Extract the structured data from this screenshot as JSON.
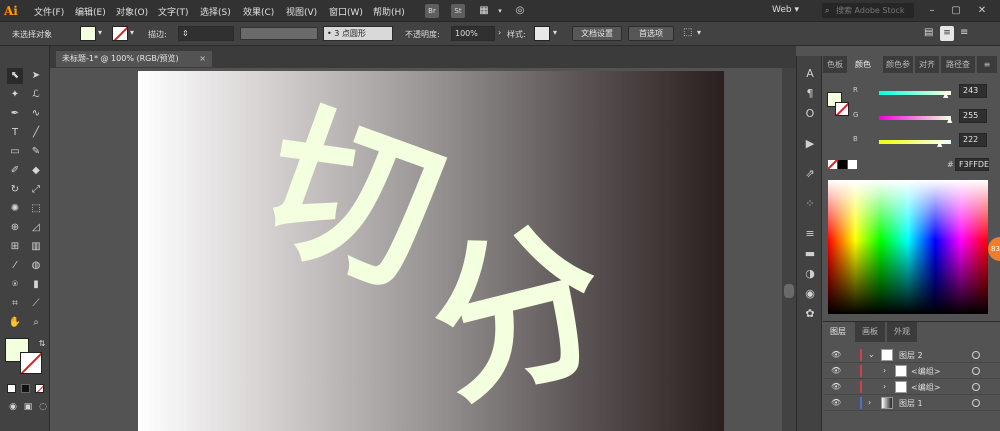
{
  "app": {
    "logo": "Ai",
    "menus": [
      "文件(F)",
      "编辑(E)",
      "对象(O)",
      "文字(T)",
      "选择(S)",
      "效果(C)",
      "视图(V)",
      "窗口(W)",
      "帮助(H)"
    ],
    "bridge_label": "Br",
    "stock_label": "St",
    "workspace": "Web",
    "search_placeholder": "搜索 Adobe Stock"
  },
  "control_bar": {
    "selection_status": "未选择对象",
    "stroke_label": "描边:",
    "brush_label": "3 点圆形",
    "opacity_label": "不透明度:",
    "opacity_value": "100%",
    "style_label": "样式:",
    "doc_setup_button": "文档设置",
    "preferences_button": "首选项"
  },
  "document": {
    "tab_title": "未标题-1* @ 100% (RGB/预览)",
    "close_glyph": "×",
    "artwork_text": [
      "切",
      "分"
    ],
    "artwork_text_color": "#F3FFDE",
    "gradient_colors": [
      "#ffffff",
      "#2a1f1e"
    ]
  },
  "color_panel": {
    "tabs": [
      "色板",
      "颜色",
      "颜色参",
      "对齐",
      "路径查"
    ],
    "active_tab": "颜色",
    "sliders": [
      {
        "label": "R",
        "value": "243"
      },
      {
        "label": "G",
        "value": "255"
      },
      {
        "label": "B",
        "value": "222"
      }
    ],
    "hex_label": "#",
    "hex_value": "F3FFDE"
  },
  "layers_panel": {
    "tabs": [
      "图层",
      "画板",
      "外观"
    ],
    "rows": [
      {
        "name": "图层 2",
        "expanded": true
      },
      {
        "name": "<编组>",
        "expanded": false
      },
      {
        "name": "<编组>",
        "expanded": false
      },
      {
        "name": "图层 1",
        "expanded": false
      }
    ]
  },
  "badge": {
    "label": "83"
  }
}
